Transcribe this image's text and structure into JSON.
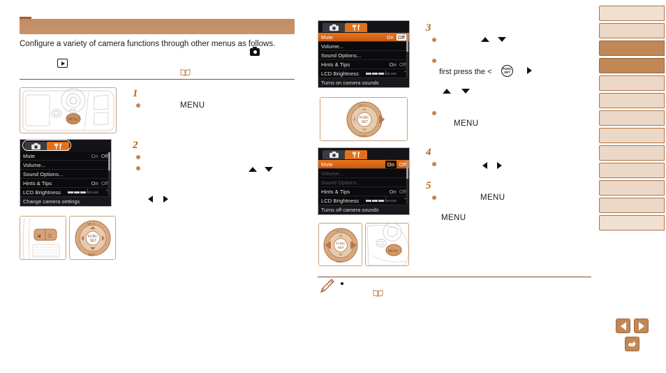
{
  "document": {
    "header_title": "",
    "intro_paragraph": "Configure a variety of camera functions through other menus as follows."
  },
  "icons": {
    "play": "play-mode-icon",
    "camera": "shooting-mode-icon",
    "book": "reference-book-icon",
    "pencil": "pencil-note-icon",
    "func_set_line1": "FUNC",
    "func_set_line2": "SET"
  },
  "menu_screens": [
    {
      "id": "menu-settings-tab",
      "tabs": [
        {
          "name": "shooting-tab",
          "glyph": "camera",
          "active": false
        },
        {
          "name": "settings-tab",
          "glyph": "wrench",
          "active": true
        }
      ],
      "tab_outline": true,
      "rows": [
        {
          "label": "Mute",
          "options": [
            {
              "text": "On",
              "state": "dim"
            },
            {
              "text": "Off",
              "state": "plain"
            }
          ],
          "selected": false,
          "dimmed": false
        },
        {
          "label": "Volume...",
          "options": [],
          "selected": false,
          "dimmed": false
        },
        {
          "label": "Sound Options...",
          "options": [],
          "selected": false,
          "dimmed": false
        },
        {
          "label": "Hints & Tips",
          "options": [
            {
              "text": "On",
              "state": "plain"
            },
            {
              "text": "Off",
              "state": "dim"
            }
          ],
          "selected": false,
          "dimmed": false
        },
        {
          "label": "LCD Brightness",
          "options": [],
          "slider": true,
          "selected": false,
          "dimmed": false
        }
      ],
      "footer": "Change camera settings",
      "scrollbar": true
    },
    {
      "id": "menu-mute-off",
      "tabs": [
        {
          "name": "shooting-tab",
          "glyph": "camera",
          "active": false
        },
        {
          "name": "settings-tab",
          "glyph": "wrench",
          "active": true
        }
      ],
      "tab_outline": false,
      "rows": [
        {
          "label": "Mute",
          "options": [
            {
              "text": "On",
              "state": "plain"
            },
            {
              "text": "Off",
              "state": "boxed"
            }
          ],
          "selected": true,
          "dimmed": false
        },
        {
          "label": "Volume...",
          "options": [],
          "selected": false,
          "dimmed": false
        },
        {
          "label": "Sound Options...",
          "options": [],
          "selected": false,
          "dimmed": false
        },
        {
          "label": "Hints & Tips",
          "options": [
            {
              "text": "On",
              "state": "plain"
            },
            {
              "text": "Off",
              "state": "dim"
            }
          ],
          "selected": false,
          "dimmed": false
        },
        {
          "label": "LCD Brightness",
          "options": [],
          "slider": true,
          "selected": false,
          "dimmed": false
        }
      ],
      "footer": "Turns on camera sounds",
      "scrollbar": true
    },
    {
      "id": "menu-mute-on",
      "tabs": [
        {
          "name": "shooting-tab",
          "glyph": "camera",
          "active": false
        },
        {
          "name": "settings-tab",
          "glyph": "wrench",
          "active": true
        }
      ],
      "tab_outline": false,
      "rows": [
        {
          "label": "Mute",
          "options": [
            {
              "text": "On",
              "state": "boxed-dark"
            },
            {
              "text": "Off",
              "state": "plain"
            }
          ],
          "selected": true,
          "dimmed": false
        },
        {
          "label": "Volume...",
          "options": [],
          "selected": false,
          "dimmed": true
        },
        {
          "label": "Sound Options...",
          "options": [],
          "selected": false,
          "dimmed": true
        },
        {
          "label": "Hints & Tips",
          "options": [
            {
              "text": "On",
              "state": "plain"
            },
            {
              "text": "Off",
              "state": "dim"
            }
          ],
          "selected": false,
          "dimmed": false
        },
        {
          "label": "LCD Brightness",
          "options": [],
          "slider": true,
          "selected": false,
          "dimmed": false
        }
      ],
      "footer": "Turns off camera sounds",
      "scrollbar": true
    }
  ],
  "steps": [
    {
      "number": "1",
      "name": "step-1",
      "bullets": [
        {
          "menu_word": "MENU"
        }
      ]
    },
    {
      "number": "2",
      "name": "step-2",
      "bullets": [
        {},
        {
          "arrows": "up-down"
        }
      ]
    },
    {
      "number": "3",
      "name": "step-3",
      "bullets": [
        {
          "arrows": "up-down"
        },
        {
          "text": "first press the <",
          "arrows": "right"
        },
        {
          "menu_word": "MENU"
        }
      ]
    },
    {
      "number": "4",
      "name": "step-4",
      "bullets": [
        {
          "arrows": "left-right"
        }
      ]
    },
    {
      "number": "5",
      "name": "step-5",
      "bullets": [
        {
          "menu_word": "MENU"
        }
      ]
    }
  ],
  "trailing_menu_word": "MENU",
  "sidebar": {
    "tabs": [
      {
        "label": "",
        "active": false,
        "light": true
      },
      {
        "label": "",
        "active": false,
        "light": false
      },
      {
        "label": "",
        "active": true,
        "light": false
      },
      {
        "label": "",
        "active": true,
        "light": false
      },
      {
        "label": "",
        "active": false,
        "light": false
      },
      {
        "label": "",
        "active": false,
        "light": false
      },
      {
        "label": "",
        "active": false,
        "light": false
      },
      {
        "label": "",
        "active": false,
        "light": false
      },
      {
        "label": "",
        "active": false,
        "light": false
      },
      {
        "label": "",
        "active": false,
        "light": false
      },
      {
        "label": "",
        "active": false,
        "light": false
      },
      {
        "label": "",
        "active": false,
        "light": false
      },
      {
        "label": "",
        "active": false,
        "light": true
      }
    ]
  },
  "nav": {
    "prev_label": "previous-page",
    "next_label": "next-page",
    "back_label": "return"
  },
  "colors": {
    "accent": "#c08856",
    "accent_dark": "#a85c2a",
    "rule": "#8a4a22",
    "highlight_orange": "#e3711c",
    "sidebar_light": "#ecd8c6"
  }
}
